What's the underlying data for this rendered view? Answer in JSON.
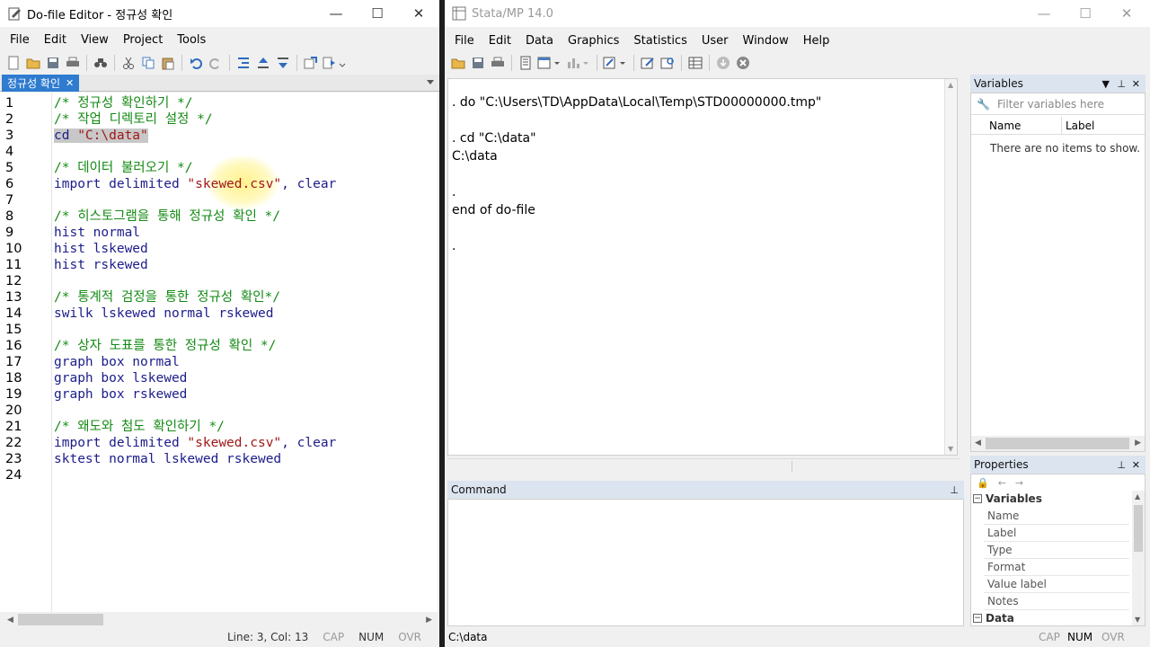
{
  "editor": {
    "title": "Do-file Editor - 정규성 확인",
    "menu": [
      "File",
      "Edit",
      "View",
      "Project",
      "Tools"
    ],
    "tab_label": "정규성 확인",
    "status": {
      "position": "Line: 3, Col: 13",
      "cap": "CAP",
      "num": "NUM",
      "ovr": "OVR"
    },
    "lines": [
      {
        "n": "1",
        "parts": [
          {
            "t": "/* 정규성 확인하기 */",
            "c": "cmt"
          }
        ]
      },
      {
        "n": "2",
        "parts": [
          {
            "t": "/* 작업 디렉토리 설정 */",
            "c": "cmt"
          }
        ]
      },
      {
        "n": "3",
        "parts": [
          {
            "t": "cd ",
            "c": "sel"
          },
          {
            "t": "\"C:\\data\"",
            "c": "sel str"
          }
        ]
      },
      {
        "n": "4",
        "parts": []
      },
      {
        "n": "5",
        "parts": [
          {
            "t": "/* 데이터 불러오기 */",
            "c": "cmt"
          }
        ]
      },
      {
        "n": "6",
        "parts": [
          {
            "t": "import delimited ",
            "c": ""
          },
          {
            "t": "\"skewed.csv\"",
            "c": "str"
          },
          {
            "t": ", clear",
            "c": ""
          }
        ]
      },
      {
        "n": "7",
        "parts": []
      },
      {
        "n": "8",
        "parts": [
          {
            "t": "/* 히스토그램을 통해 정규성 확인 */",
            "c": "cmt"
          }
        ]
      },
      {
        "n": "9",
        "parts": [
          {
            "t": "hist normal",
            "c": ""
          }
        ]
      },
      {
        "n": "10",
        "parts": [
          {
            "t": "hist lskewed",
            "c": ""
          }
        ]
      },
      {
        "n": "11",
        "parts": [
          {
            "t": "hist rskewed",
            "c": ""
          }
        ]
      },
      {
        "n": "12",
        "parts": []
      },
      {
        "n": "13",
        "parts": [
          {
            "t": "/* 통계적 검정을 통한 정규성 확인*/",
            "c": "cmt"
          }
        ]
      },
      {
        "n": "14",
        "parts": [
          {
            "t": "swilk lskewed normal rskewed",
            "c": ""
          }
        ]
      },
      {
        "n": "15",
        "parts": []
      },
      {
        "n": "16",
        "parts": [
          {
            "t": "/* 상자 도표를 통한 정규성 확인 */",
            "c": "cmt"
          }
        ]
      },
      {
        "n": "17",
        "parts": [
          {
            "t": "graph box normal",
            "c": ""
          }
        ]
      },
      {
        "n": "18",
        "parts": [
          {
            "t": "graph box lskewed",
            "c": ""
          }
        ]
      },
      {
        "n": "19",
        "parts": [
          {
            "t": "graph box rskewed",
            "c": ""
          }
        ]
      },
      {
        "n": "20",
        "parts": []
      },
      {
        "n": "21",
        "parts": [
          {
            "t": "/* 왜도와 첨도 확인하기 */",
            "c": "cmt"
          }
        ]
      },
      {
        "n": "22",
        "parts": [
          {
            "t": "import delimited ",
            "c": ""
          },
          {
            "t": "\"skewed.csv\"",
            "c": "str"
          },
          {
            "t": ", clear",
            "c": ""
          }
        ]
      },
      {
        "n": "23",
        "parts": [
          {
            "t": "sktest normal lskewed rskewed",
            "c": ""
          }
        ]
      },
      {
        "n": "24",
        "parts": []
      }
    ]
  },
  "stata": {
    "title": "Stata/MP 14.0",
    "menu": [
      "File",
      "Edit",
      "Data",
      "Graphics",
      "Statistics",
      "User",
      "Window",
      "Help"
    ],
    "results": [
      ". do \"C:\\Users\\TD\\AppData\\Local\\Temp\\STD00000000.tmp\"",
      "",
      ". cd \"C:\\data\"",
      "C:\\data",
      "",
      ".",
      "end of do-file",
      "",
      "."
    ],
    "variables": {
      "title": "Variables",
      "filter_placeholder": "Filter variables here",
      "col_name": "Name",
      "col_label": "Label",
      "empty": "There are no items to show."
    },
    "properties": {
      "title": "Properties",
      "group_variables": "Variables",
      "rows": [
        "Name",
        "Label",
        "Type",
        "Format",
        "Value label",
        "Notes"
      ],
      "group_data": "Data"
    },
    "command": {
      "title": "Command"
    },
    "status": {
      "path": "C:\\data",
      "cap": "CAP",
      "num": "NUM",
      "ovr": "OVR"
    }
  }
}
